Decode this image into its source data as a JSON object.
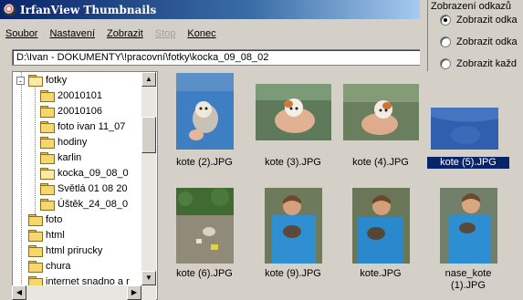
{
  "window": {
    "title": "IrfanView Thumbnails"
  },
  "menu": {
    "items": [
      "Soubor",
      "Nastavení",
      "Zobrazit",
      "Stop",
      "Konec"
    ]
  },
  "path": {
    "value": "D:\\Ivan - DOKUMENTY\\!pracovní\\fotky\\kocka_09_08_02"
  },
  "dialog": {
    "legend": "Zobrazení odkazů",
    "options": [
      "Zobrazit odka",
      "Zobrazit odka",
      "Zobrazit každ"
    ]
  },
  "tree": {
    "items": [
      {
        "label": "fotky",
        "level": 0,
        "expander": "-"
      },
      {
        "label": "20010101",
        "level": 1
      },
      {
        "label": "20010106",
        "level": 1
      },
      {
        "label": "foto ivan 11_07",
        "level": 1
      },
      {
        "label": "hodiny",
        "level": 1
      },
      {
        "label": "karlin",
        "level": 1
      },
      {
        "label": "kocka_09_08_0",
        "level": 1,
        "open": true
      },
      {
        "label": "Světlá 01 08 20",
        "level": 1
      },
      {
        "label": "Úštěk_24_08_0",
        "level": 1
      },
      {
        "label": "foto",
        "level": 0
      },
      {
        "label": "html",
        "level": 0
      },
      {
        "label": "html prirucky",
        "level": 0
      },
      {
        "label": "chura",
        "level": 0
      },
      {
        "label": "internet snadno a r",
        "level": 0
      }
    ]
  },
  "thumbnails": [
    {
      "caption": "kote (2).JPG",
      "selected": false,
      "scene": "kitten-blue"
    },
    {
      "caption": "kote (3).JPG",
      "selected": false,
      "scene": "kitten-hand"
    },
    {
      "caption": "kote (4).JPG",
      "selected": false,
      "scene": "kitten-hand2"
    },
    {
      "caption": "kote (5).JPG",
      "selected": true,
      "scene": "blue-shirt"
    },
    {
      "caption": "kote (6).JPG",
      "selected": false,
      "scene": "garden"
    },
    {
      "caption": "kote (9).JPG",
      "selected": false,
      "scene": "person-cat"
    },
    {
      "caption": "kote.JPG",
      "selected": false,
      "scene": "person-cat"
    },
    {
      "caption": "nase_kote\n(1).JPG",
      "selected": false,
      "scene": "person-cat2"
    }
  ]
}
